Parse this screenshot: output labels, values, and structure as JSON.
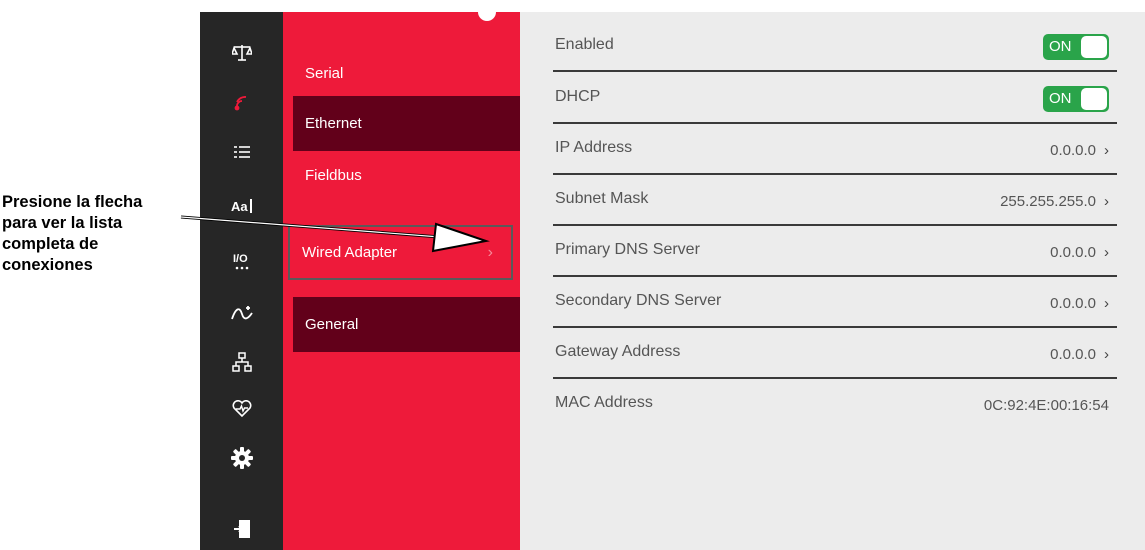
{
  "callout": {
    "lines": [
      "Presione la flecha",
      "para ver la lista",
      "completa de",
      "conexiones"
    ]
  },
  "rail": {
    "icons": [
      "scale-icon",
      "wireless-icon",
      "list-icon",
      "font-icon",
      "io-icon",
      "workflow-icon",
      "network-icon",
      "heart-monitor-icon",
      "gear-icon",
      "logout-icon"
    ],
    "active_color": "#ee1a3a"
  },
  "menu": {
    "items": [
      {
        "label": "Serial"
      },
      {
        "label": "Ethernet"
      },
      {
        "label": "Fieldbus"
      },
      {
        "label": "Wired Adapter"
      },
      {
        "label": "General"
      }
    ]
  },
  "settings": {
    "rows": [
      {
        "label": "Enabled",
        "toggle": "ON"
      },
      {
        "label": "DHCP",
        "toggle": "ON"
      },
      {
        "label": "IP Address",
        "value": "0.0.0.0"
      },
      {
        "label": "Subnet Mask",
        "value": "255.255.255.0"
      },
      {
        "label": "Primary DNS Server",
        "value": "0.0.0.0"
      },
      {
        "label": "Secondary DNS Server",
        "value": "0.0.0.0"
      },
      {
        "label": "Gateway Address",
        "value": "0.0.0.0"
      },
      {
        "label": "MAC Address",
        "value": "0C:92:4E:00:16:54"
      }
    ]
  },
  "colors": {
    "menu_bg": "#ee1a3a",
    "menu_selected": "#62001a",
    "rail_bg": "#262626",
    "toggle_on": "#2aa44a"
  }
}
